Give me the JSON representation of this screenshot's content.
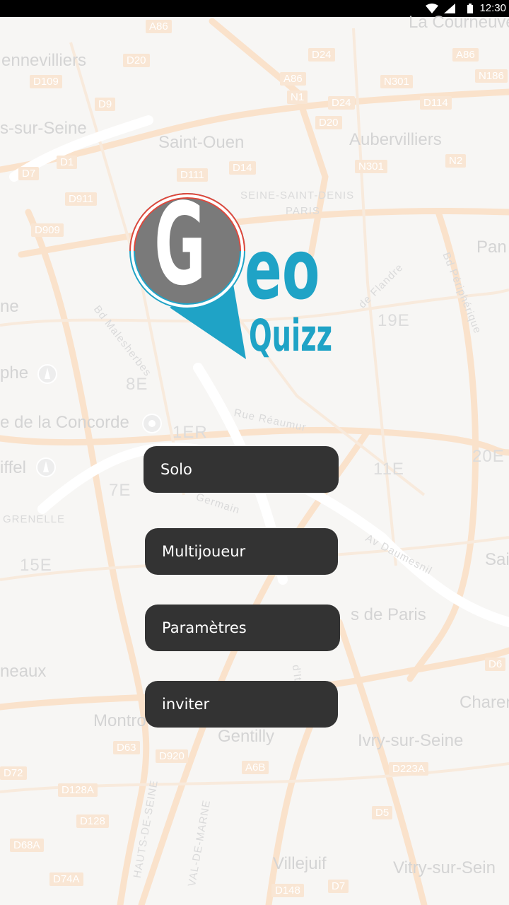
{
  "status_bar": {
    "time": "12:30"
  },
  "map": {
    "places": [
      "La Courneuve",
      "ennevilliers",
      "s-sur-Seine",
      "Saint-Ouen",
      "Aubervilliers",
      "SEINE-SAINT-DENIS",
      "PARIS",
      "Pan",
      "ne",
      "19E",
      "phe",
      "8E",
      "e de la Concorde",
      "1ER",
      "Rue Réaumur",
      "iffel",
      "11E",
      "20E",
      "7E",
      "GRENELLE",
      "15E",
      "Germain",
      "Av Daumesnil",
      "s de Paris",
      "Sai",
      "neaux",
      "Montro",
      "Gentilly",
      "Ivry-sur-Seine",
      "Charen",
      "Villejuif",
      "Vitry-sur-Sein",
      "Bd Malesherbes",
      "Bd Périphérique",
      "HAUTS-DE-SEINE",
      "VAL-DE-MARNE",
      "de Flandre",
      "d'Ita"
    ],
    "roads": [
      "A86",
      "D20",
      "D24",
      "A86",
      "D109",
      "N301",
      "N186",
      "D9",
      "A86",
      "D114",
      "N1",
      "D24",
      "D20",
      "D1",
      "N301",
      "N2",
      "D7",
      "D111",
      "D14",
      "D911",
      "D909",
      "D6",
      "D63",
      "D920",
      "A6B",
      "D223A",
      "D72",
      "D128A",
      "D5",
      "D128",
      "D68A",
      "D74A",
      "D148",
      "D7"
    ]
  },
  "logo": {
    "letter": "G",
    "word": "eo",
    "sub": "Quizz"
  },
  "menu": {
    "solo": "Solo",
    "multiplayer": "Multijoueur",
    "settings": "Paramètres",
    "invite": "inviter"
  },
  "colors": {
    "accent_blue": "#1fa3c6",
    "ring_red": "#e0473a",
    "pin_gray": "#7a7a7a",
    "button_bg": "#333333"
  }
}
